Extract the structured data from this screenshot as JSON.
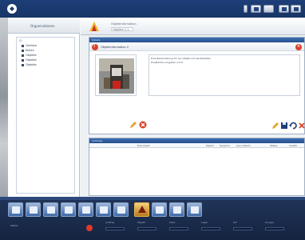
{
  "colors": {
    "titlebar": "#1d3e78",
    "accent": "#24508f",
    "danger": "#d8422b",
    "taskbar": "#15243f"
  },
  "titlebar": {
    "logo_icon": "app-logo-icon",
    "buttons": [
      "monitor-icon",
      "info-icon",
      "window-icon",
      "flag-icon",
      "close-icon"
    ]
  },
  "left_panel": {
    "header_label": "Organisationen",
    "tree_root": "ID",
    "tree_items": [
      "Gerüste",
      "Kisten",
      "Objekte",
      "Objekte",
      "Objekte"
    ]
  },
  "content_header": {
    "title": "Objektinformation",
    "subtitle": "Objekte 1.1"
  },
  "top_panel": {
    "bar_label": "Details",
    "object_title": "Objektinformation 2",
    "description_lines": [
      "Eine Beschreibung für ein Objekt mit Gerätedaten",
      "Zusätzliche Angaben 1.0.0"
    ]
  },
  "bottom_panel": {
    "bar_label": "Anhänge",
    "columns": [
      "Dokument",
      "Datum",
      "Seriennr.",
      "Aus. Datum",
      "Status",
      "Anzahl"
    ]
  },
  "taskbar": {
    "buttons": [
      "home-icon",
      "truck-icon",
      "check-icon",
      "pencil-icon",
      "mail-icon",
      "document-icon",
      "folder-icon",
      "warning-icon",
      "tools-icon",
      "calendar-icon",
      "print-icon"
    ],
    "label": "Status",
    "readouts": [
      {
        "label": "Auftrag"
      },
      {
        "label": "Objekt"
      },
      {
        "label": "Kiste"
      },
      {
        "label": "Lager"
      },
      {
        "label": "Ort"
      },
      {
        "label": "Gruppe"
      }
    ]
  }
}
